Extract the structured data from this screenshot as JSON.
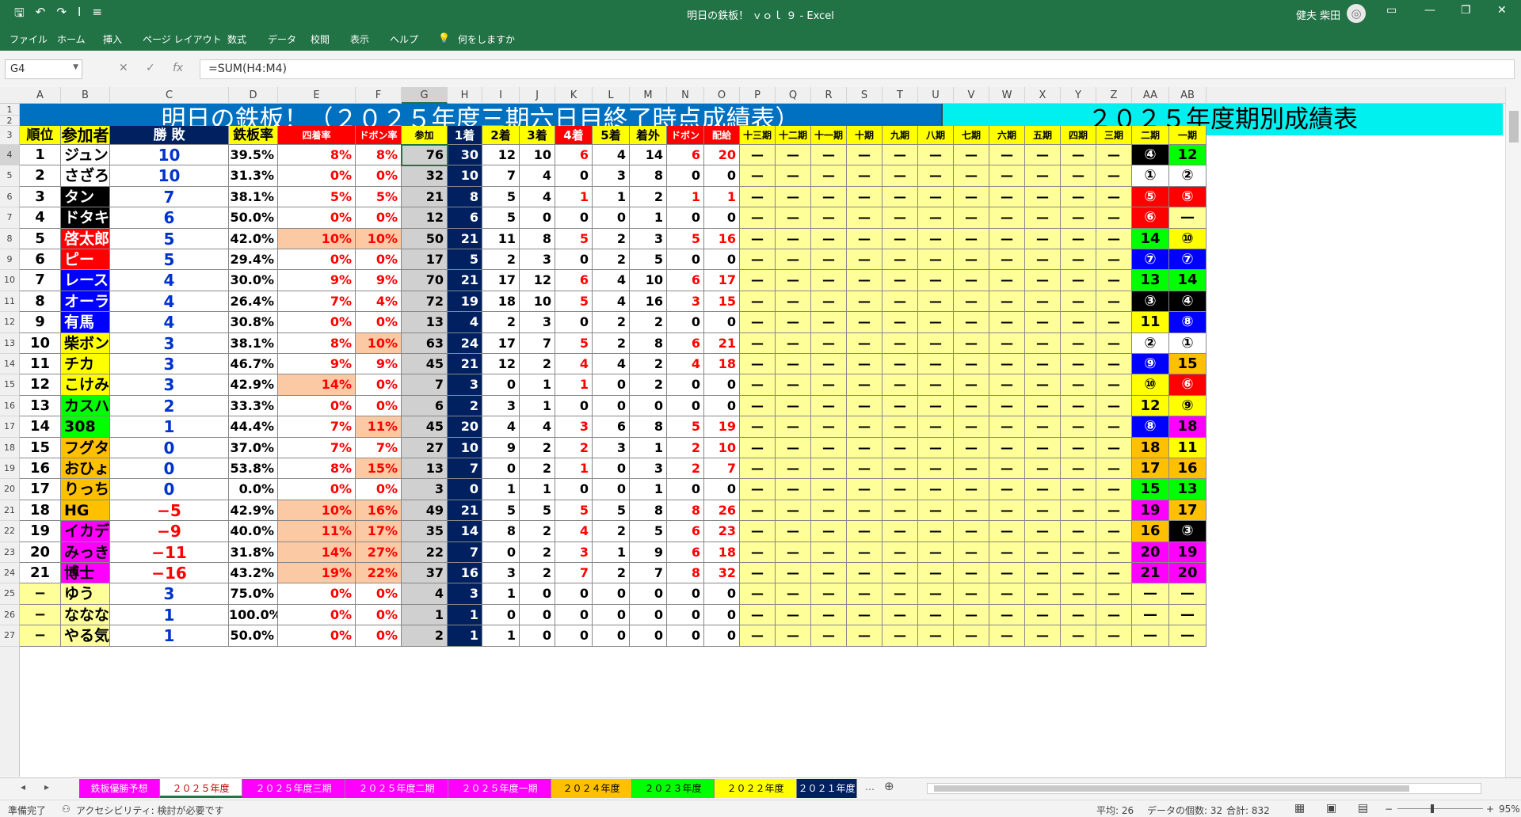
{
  "window": {
    "title": "明日の鉄板！ ｖｏｌ ９ - Excel",
    "user": "健夫 柴田",
    "avatar": "◎",
    "controls": [
      "▭",
      "—",
      "❐",
      "✕"
    ]
  },
  "qat": [
    "🖫",
    "↶",
    "↷",
    "I",
    "≡"
  ],
  "ribbon": {
    "menus": [
      "ファイル",
      "ホーム",
      "挿入",
      "ページ レイアウト",
      "数式",
      "データ",
      "校閲",
      "表示",
      "ヘルプ",
      "何をしますか"
    ]
  },
  "formula_bar": {
    "name_box": "G4",
    "cancel": "✕",
    "enter": "✓",
    "fx": "fx",
    "formula": "=SUM(H4:M4)"
  },
  "columns": [
    "A",
    "B",
    "C",
    "D",
    "E",
    "F",
    "G",
    "H",
    "I",
    "J",
    "K",
    "L",
    "M",
    "N",
    "O",
    "P",
    "Q",
    "R",
    "S",
    "T",
    "U",
    "V",
    "W",
    "X",
    "Y",
    "Z",
    "AA",
    "AB"
  ],
  "rows": [
    "1",
    "2",
    "3",
    "4",
    "5",
    "6",
    "7",
    "8",
    "9",
    "10",
    "11",
    "12",
    "13",
    "14",
    "15",
    "16",
    "17",
    "18",
    "19",
    "20",
    "21",
    "22",
    "23",
    "24",
    "25",
    "26",
    "27"
  ],
  "sheet": {
    "banner_left": "明日の鉄板！（２０２５年度三期六日目終了時点成績表）",
    "banner_right": "２０２５年度期別成績表",
    "headers": [
      "順位",
      "参加者",
      "勝 敗",
      "鉄板率",
      "四着率",
      "ドボン率",
      "参加",
      "1着",
      "2着",
      "3着",
      "4着",
      "5着",
      "着外",
      "ドボン",
      "配給",
      "十三期",
      "十二期",
      "十一期",
      "十期",
      "九期",
      "八期",
      "七期",
      "六期",
      "五期",
      "四期",
      "三期",
      "二期",
      "一期"
    ],
    "rows": [
      [
        "1",
        "ジュンイチ",
        "10",
        "39.5%",
        "8%",
        "8%",
        "76",
        "30",
        "12",
        "10",
        "6",
        "4",
        "14",
        "6",
        "20",
        "④",
        "12"
      ],
      [
        "2",
        "さざろー",
        "10",
        "31.3%",
        "0%",
        "0%",
        "32",
        "10",
        "7",
        "4",
        "0",
        "3",
        "8",
        "0",
        "0",
        "①",
        "②"
      ],
      [
        "3",
        "タン",
        "7",
        "38.1%",
        "5%",
        "5%",
        "21",
        "8",
        "5",
        "4",
        "1",
        "1",
        "2",
        "1",
        "1",
        "⑤",
        "⑤"
      ],
      [
        "4",
        "ドタキャン帝王",
        "6",
        "50.0%",
        "0%",
        "0%",
        "12",
        "6",
        "5",
        "0",
        "0",
        "0",
        "1",
        "0",
        "0",
        "⑥",
        "—"
      ],
      [
        "5",
        "啓太郎",
        "5",
        "42.0%",
        "10%",
        "10%",
        "50",
        "21",
        "11",
        "8",
        "5",
        "2",
        "3",
        "5",
        "16",
        "14",
        "⑩"
      ],
      [
        "6",
        "ピー",
        "5",
        "29.4%",
        "0%",
        "0%",
        "17",
        "5",
        "2",
        "3",
        "0",
        "2",
        "5",
        "0",
        "0",
        "⑦",
        "⑦"
      ],
      [
        "7",
        "レースアナもどき",
        "4",
        "30.0%",
        "9%",
        "9%",
        "70",
        "21",
        "17",
        "12",
        "6",
        "4",
        "10",
        "6",
        "17",
        "13",
        "14"
      ],
      [
        "8",
        "オーライ",
        "4",
        "26.4%",
        "7%",
        "4%",
        "72",
        "19",
        "18",
        "10",
        "5",
        "4",
        "16",
        "3",
        "15",
        "③",
        "④"
      ],
      [
        "9",
        "有馬",
        "4",
        "30.8%",
        "0%",
        "0%",
        "13",
        "4",
        "2",
        "3",
        "0",
        "2",
        "2",
        "0",
        "0",
        "11",
        "⑧"
      ],
      [
        "10",
        "柴ボン",
        "3",
        "38.1%",
        "8%",
        "10%",
        "63",
        "24",
        "17",
        "7",
        "5",
        "2",
        "8",
        "6",
        "21",
        "②",
        "①"
      ],
      [
        "11",
        "チカ",
        "3",
        "46.7%",
        "9%",
        "9%",
        "45",
        "21",
        "12",
        "2",
        "4",
        "4",
        "2",
        "4",
        "18",
        "⑨",
        "15"
      ],
      [
        "12",
        "こけみど",
        "3",
        "42.9%",
        "14%",
        "0%",
        "7",
        "3",
        "0",
        "1",
        "1",
        "0",
        "2",
        "0",
        "0",
        "⑩",
        "⑥"
      ],
      [
        "13",
        "カスハラ兄",
        "2",
        "33.3%",
        "0%",
        "0%",
        "6",
        "2",
        "3",
        "1",
        "0",
        "0",
        "0",
        "0",
        "0",
        "12",
        "⑨"
      ],
      [
        "14",
        "308",
        "1",
        "44.4%",
        "7%",
        "11%",
        "45",
        "20",
        "4",
        "4",
        "3",
        "6",
        "8",
        "5",
        "19",
        "⑧",
        "18"
      ],
      [
        "15",
        "フグタ",
        "0",
        "37.0%",
        "7%",
        "7%",
        "27",
        "10",
        "9",
        "2",
        "2",
        "3",
        "1",
        "2",
        "10",
        "18",
        "11"
      ],
      [
        "16",
        "おひょい",
        "0",
        "53.8%",
        "8%",
        "15%",
        "13",
        "7",
        "0",
        "2",
        "1",
        "0",
        "3",
        "2",
        "7",
        "17",
        "16"
      ],
      [
        "17",
        "りっちゃん",
        "0",
        "0.0%",
        "0%",
        "0%",
        "3",
        "0",
        "1",
        "1",
        "0",
        "0",
        "1",
        "0",
        "0",
        "15",
        "13"
      ],
      [
        "18",
        "HG",
        "−5",
        "42.9%",
        "10%",
        "16%",
        "49",
        "21",
        "5",
        "5",
        "5",
        "5",
        "8",
        "8",
        "26",
        "19",
        "17"
      ],
      [
        "19",
        "イカデビル",
        "−9",
        "40.0%",
        "11%",
        "17%",
        "35",
        "14",
        "8",
        "2",
        "4",
        "2",
        "5",
        "6",
        "23",
        "16",
        "③"
      ],
      [
        "20",
        "みっきぃ",
        "−11",
        "31.8%",
        "14%",
        "27%",
        "22",
        "7",
        "0",
        "2",
        "3",
        "1",
        "9",
        "6",
        "18",
        "20",
        "19"
      ],
      [
        "21",
        "博士",
        "−16",
        "43.2%",
        "19%",
        "22%",
        "37",
        "16",
        "3",
        "2",
        "7",
        "2",
        "7",
        "8",
        "32",
        "21",
        "20"
      ],
      [
        "−",
        "ゆう",
        "3",
        "75.0%",
        "0%",
        "0%",
        "4",
        "3",
        "1",
        "0",
        "0",
        "0",
        "0",
        "0",
        "0",
        "—",
        "—"
      ],
      [
        "−",
        "ななな",
        "1",
        "100.0%",
        "0%",
        "0%",
        "1",
        "1",
        "0",
        "0",
        "0",
        "0",
        "0",
        "0",
        "0",
        "—",
        "—"
      ],
      [
        "−",
        "やる気元気いわき",
        "1",
        "50.0%",
        "0%",
        "0%",
        "2",
        "1",
        "1",
        "0",
        "0",
        "0",
        "0",
        "0",
        "0",
        "—",
        "—"
      ]
    ],
    "period_dash": "—"
  },
  "tabs": [
    "鉄板優勝予想",
    "２０２５年度",
    "２０２５年度三期",
    "２０２５年度二期",
    "２０２５年度一期",
    "２０２４年度",
    "２０２３年度",
    "２０２２年度",
    "２０２１年度"
  ],
  "tab_nav": [
    "◂",
    "▸",
    "…",
    "⊕"
  ],
  "status": {
    "ready": "準備完了",
    "accessibility": "アクセシビリティ: 検討が必要です",
    "average": "平均: 26",
    "count": "データの個数: 32",
    "sum": "合計: 832",
    "zoom": "95%",
    "view_icons": [
      "▦",
      "▣",
      "▤"
    ],
    "zoom_minus": "−",
    "zoom_plus": "+"
  },
  "colors": {
    "excel_green": "#217346",
    "header_yellow": "#ffff00",
    "banner_blue": "#0070c0",
    "banner_cyan": "#00f0f0",
    "first_col": "#002060",
    "pale_yellow": "#ffff99",
    "gray": "#d0d0d0",
    "salmon": "#fbc9a4"
  }
}
